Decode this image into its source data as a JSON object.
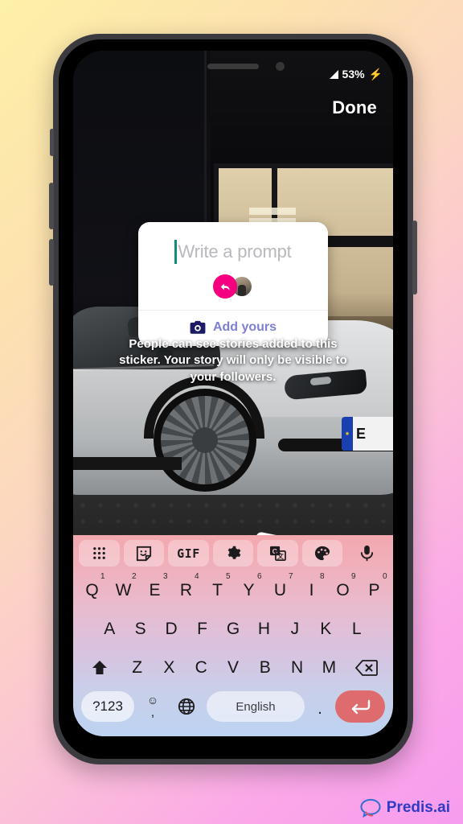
{
  "background": {
    "gradient_from": "#fdf0a8",
    "gradient_to": "#f79cee"
  },
  "device": {
    "frame_color": "#3b3b3f",
    "buttons": [
      {
        "name": "mute-switch"
      },
      {
        "name": "volume-up-button"
      },
      {
        "name": "volume-down-button"
      },
      {
        "name": "power-button"
      }
    ]
  },
  "status_bar": {
    "signal_icon": "signal-triangle-icon",
    "battery_percent": "53%",
    "charging_icon": "charging-bolt-icon",
    "charging_glyph": "⚡"
  },
  "app": {
    "done_label": "Done",
    "hint_text": "People can see stories added to this sticker. Your story will only be visible to your followers."
  },
  "prompt_card": {
    "placeholder": "Write a prompt",
    "caret_color": "#0f8c7e",
    "reply_badge_icon": "reply-arrow-icon",
    "reply_badge_color": "#f5007f",
    "avatar_icon": "avatar",
    "add_yours_label": "Add yours",
    "add_yours_icon": "camera-icon",
    "add_yours_color": "#7d7fd4"
  },
  "photo": {
    "dice_sticker": "dice-sticker",
    "license_plate": "E",
    "eu_stars": "★"
  },
  "keyboard": {
    "toolbar": [
      {
        "name": "apps-grid-icon",
        "label": ""
      },
      {
        "name": "sticker-icon",
        "label": ""
      },
      {
        "name": "gif-icon",
        "label": "GIF"
      },
      {
        "name": "settings-gear-icon",
        "label": ""
      },
      {
        "name": "translate-icon",
        "label": ""
      },
      {
        "name": "theme-palette-icon",
        "label": ""
      },
      {
        "name": "microphone-icon",
        "label": ""
      }
    ],
    "row1": [
      {
        "key": "Q",
        "num": "1"
      },
      {
        "key": "W",
        "num": "2"
      },
      {
        "key": "E",
        "num": "3"
      },
      {
        "key": "R",
        "num": "4"
      },
      {
        "key": "T",
        "num": "5"
      },
      {
        "key": "Y",
        "num": "6"
      },
      {
        "key": "U",
        "num": "7"
      },
      {
        "key": "I",
        "num": "8"
      },
      {
        "key": "O",
        "num": "9"
      },
      {
        "key": "P",
        "num": "0"
      }
    ],
    "row2": [
      {
        "key": "A"
      },
      {
        "key": "S"
      },
      {
        "key": "D"
      },
      {
        "key": "F"
      },
      {
        "key": "G"
      },
      {
        "key": "H"
      },
      {
        "key": "J"
      },
      {
        "key": "K"
      },
      {
        "key": "L"
      }
    ],
    "row3": [
      {
        "key": "Z"
      },
      {
        "key": "X"
      },
      {
        "key": "C"
      },
      {
        "key": "V"
      },
      {
        "key": "B"
      },
      {
        "key": "N"
      },
      {
        "key": "M"
      }
    ],
    "shift_icon": "shift-icon",
    "backspace_icon": "backspace-icon",
    "numbers_label": "?123",
    "emoji_icon": "emoji-icon",
    "comma_label": ",",
    "globe_icon": "globe-icon",
    "space_label": "English",
    "period_label": ".",
    "enter_icon": "enter-icon",
    "enter_color": "#de6b6d"
  },
  "watermark": {
    "text": "Predis.ai",
    "icon": "speech-bubble-logo",
    "color": "#2e3bc4"
  }
}
